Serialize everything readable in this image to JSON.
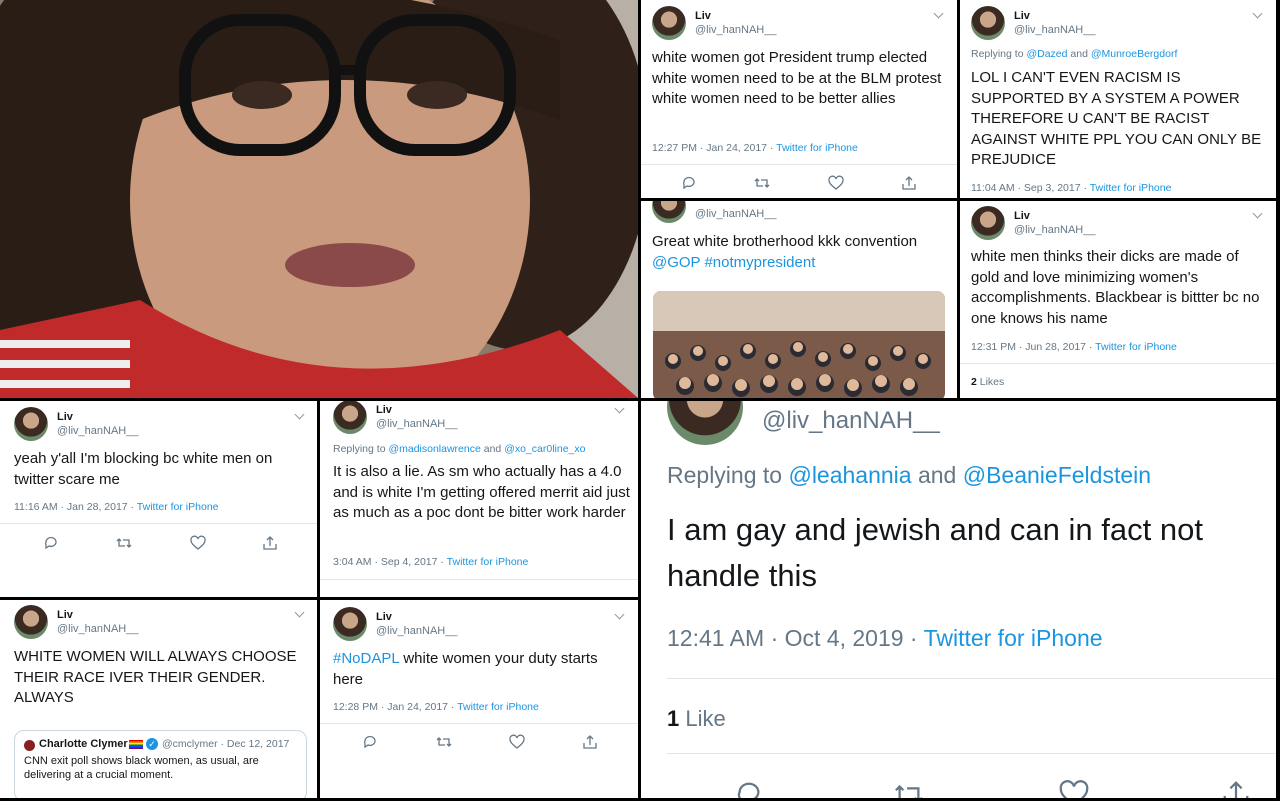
{
  "common": {
    "name": "Liv",
    "handle": "@liv_hanNAH__",
    "source": "Twitter for iPhone",
    "sep": " · "
  },
  "t1": {
    "text": "white women got President trump elected white women need to be at the BLM protest white women need to be better allies",
    "time": "12:27 PM · Jan 24, 2017"
  },
  "t2": {
    "reply_prefix": "Replying to ",
    "reply_a": "@Dazed",
    "reply_and": " and ",
    "reply_b": "@MunroeBergdorf",
    "text": "LOL I CAN'T EVEN RACISM IS SUPPORTED BY A SYSTEM A POWER THEREFORE U CAN'T BE RACIST AGAINST WHITE PPL YOU CAN ONLY BE PREJUDICE",
    "time": "11:04 AM · Sep 3, 2017"
  },
  "t3": {
    "text": "Great white brotherhood kkk convention ",
    "tag1": "@GOP",
    "tag2": "#notmypresident"
  },
  "t4": {
    "text": "white men thinks their dicks are made of gold and love minimizing  women's accomplishments. Blackbear is bittter bc no one knows his name",
    "time": "12:31 PM · Jun 28, 2017",
    "likes_count": "2",
    "likes_label": " Likes"
  },
  "t5": {
    "text": "yeah y'all I'm blocking bc white men on twitter scare me",
    "time": "11:16 AM · Jan 28, 2017"
  },
  "t6": {
    "reply_prefix": "Replying to ",
    "reply_a": "@madisonlawrence",
    "reply_and": " and ",
    "reply_b": "@xo_car0line_xo",
    "text": "It is also a lie. As sm who actually has a 4.0 and is white I'm getting offered merrit aid just as much as a poc dont be bitter work harder",
    "time": "3:04 AM · Sep 4, 2017"
  },
  "t7": {
    "reply_prefix": "Replying to ",
    "reply_a": "@leahannia",
    "reply_and": " and ",
    "reply_b": "@BeanieFeldstein",
    "text": "I am gay and jewish and can in fact not handle this",
    "time": "12:41 AM · Oct 4, 2019",
    "likes_count": "1",
    "likes_label": " Like"
  },
  "t8": {
    "text": "WHITE WOMEN WILL ALWAYS CHOOSE THEIR RACE IVER THEIR GENDER. ALWAYS",
    "quote": {
      "name": "Charlotte Clymer",
      "handle": "@cmclymer",
      "date": " · Dec 12, 2017",
      "text": "CNN exit poll shows black women, as usual, are delivering at a crucial moment."
    }
  },
  "t9": {
    "tag": "#NoDAPL",
    "text": " white women your duty starts here",
    "time": "12:28 PM · Jan 24, 2017"
  },
  "colors": {
    "link": "#1b95e0",
    "meta": "#657786",
    "border": "#000000"
  },
  "icons": [
    "reply-icon",
    "retweet-icon",
    "like-icon",
    "share-icon",
    "chevron-down-icon",
    "verified-icon"
  ]
}
